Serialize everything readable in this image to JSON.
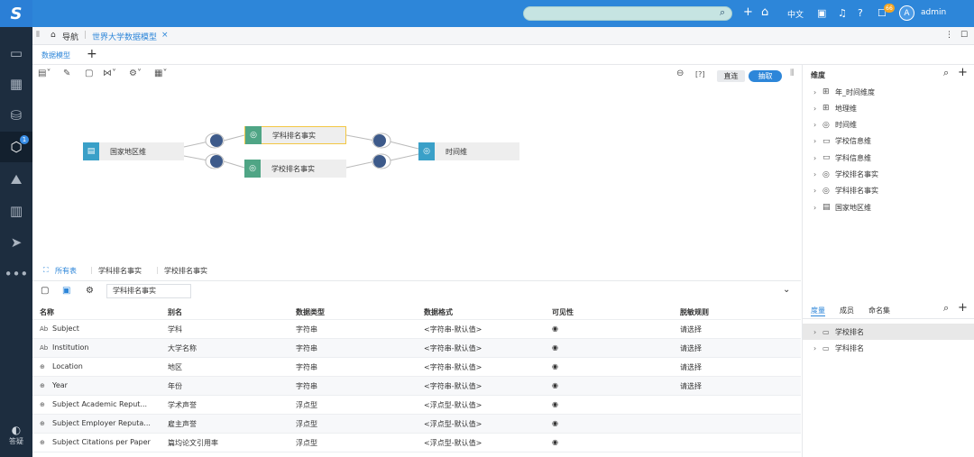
{
  "nav": {
    "logo": "S",
    "items": [
      "monitor-icon",
      "dashboard-icon",
      "database-icon",
      "cube-icon",
      "chart-icon",
      "bar-chart-icon",
      "send-icon",
      "more-icon"
    ],
    "active_badge": "1",
    "answer_label": "答疑"
  },
  "topbar": {
    "lang": "中文",
    "msg_count": "66",
    "avatar": "A",
    "username": "admin"
  },
  "tabs": {
    "home": "导航",
    "current": "世界大学数据模型"
  },
  "subtabs": {
    "model": "数据模型"
  },
  "canvas": {
    "direct": "直连",
    "extract": "抽取",
    "help": "[?]",
    "nodes": {
      "country": "国家地区维",
      "subject_rank": "学科排名事实",
      "school_rank": "学校排名事实",
      "time": "时间维"
    }
  },
  "bottom_tabs": {
    "all": "所有表",
    "t1": "学科排名事实",
    "t2": "学校排名事实"
  },
  "filter_value": "学科排名事实",
  "table": {
    "headers": [
      "名称",
      "别名",
      "数据类型",
      "数据格式",
      "可见性",
      "脱敏规则"
    ],
    "rows": [
      {
        "icon": "Ab",
        "name": "Subject",
        "alias": "学科",
        "type": "字符串",
        "format": "<字符串-默认值>",
        "rule": "请选择"
      },
      {
        "icon": "Ab",
        "name": "Institution",
        "alias": "大学名称",
        "type": "字符串",
        "format": "<字符串-默认值>",
        "rule": "请选择"
      },
      {
        "icon": "⊕",
        "name": "Location",
        "alias": "地区",
        "type": "字符串",
        "format": "<字符串-默认值>",
        "rule": "请选择"
      },
      {
        "icon": "⊕",
        "name": "Year",
        "alias": "年份",
        "type": "字符串",
        "format": "<字符串-默认值>",
        "rule": "请选择"
      },
      {
        "icon": "⊕",
        "name": "Subject Academic Reput...",
        "alias": "学术声誉",
        "type": "浮点型",
        "format": "<浮点型-默认值>",
        "rule": ""
      },
      {
        "icon": "⊕",
        "name": "Subject Employer Reputa...",
        "alias": "雇主声誉",
        "type": "浮点型",
        "format": "<浮点型-默认值>",
        "rule": ""
      },
      {
        "icon": "⊕",
        "name": "Subject Citations per Paper",
        "alias": "篇均论文引用率",
        "type": "浮点型",
        "format": "<浮点型-默认值>",
        "rule": ""
      }
    ]
  },
  "right_panel": {
    "title": "维度",
    "dimensions": [
      {
        "icon": "hierarchy-icon",
        "label": "年_时间维度"
      },
      {
        "icon": "hierarchy-icon",
        "label": "地理维"
      },
      {
        "icon": "dimension-icon",
        "label": "时间维"
      },
      {
        "icon": "folder-icon",
        "label": "学校信息维"
      },
      {
        "icon": "folder-icon",
        "label": "学科信息维"
      },
      {
        "icon": "fact-icon",
        "label": "学校排名事实"
      },
      {
        "icon": "fact-icon",
        "label": "学科排名事实"
      },
      {
        "icon": "table-icon",
        "label": "国家地区维"
      }
    ],
    "tabs": [
      "度量",
      "成员",
      "命名集"
    ],
    "measures": [
      {
        "label": "学校排名"
      },
      {
        "label": "学科排名"
      }
    ]
  }
}
